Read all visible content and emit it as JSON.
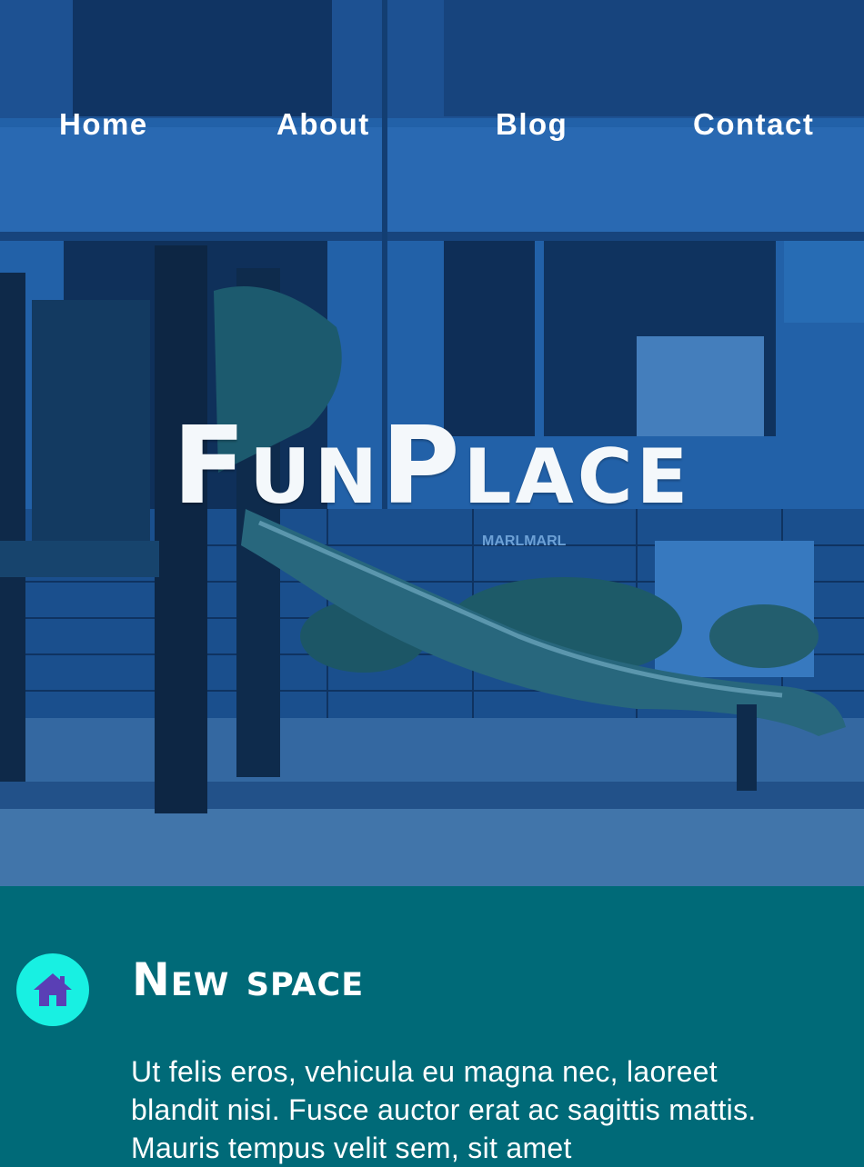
{
  "nav": {
    "items": [
      {
        "label": "Home"
      },
      {
        "label": "About"
      },
      {
        "label": "Blog"
      },
      {
        "label": "Contact"
      }
    ]
  },
  "hero": {
    "brand": "FunPlace",
    "overlay_color": "#1c5a9a",
    "background_image": "playground-slide-photo",
    "sign_text": "MARLMARL"
  },
  "feature": {
    "icon": "home-icon",
    "icon_bg_color": "#18f0e2",
    "icon_color": "#5a3fb5",
    "title": "New space",
    "text": "Ut felis eros, vehicula eu magna nec, laoreet blandit nisi. Fusce auctor erat ac sagittis mattis. Mauris tempus velit sem, sit amet"
  },
  "colors": {
    "section_bg": "#006a78",
    "text": "#ffffff"
  }
}
